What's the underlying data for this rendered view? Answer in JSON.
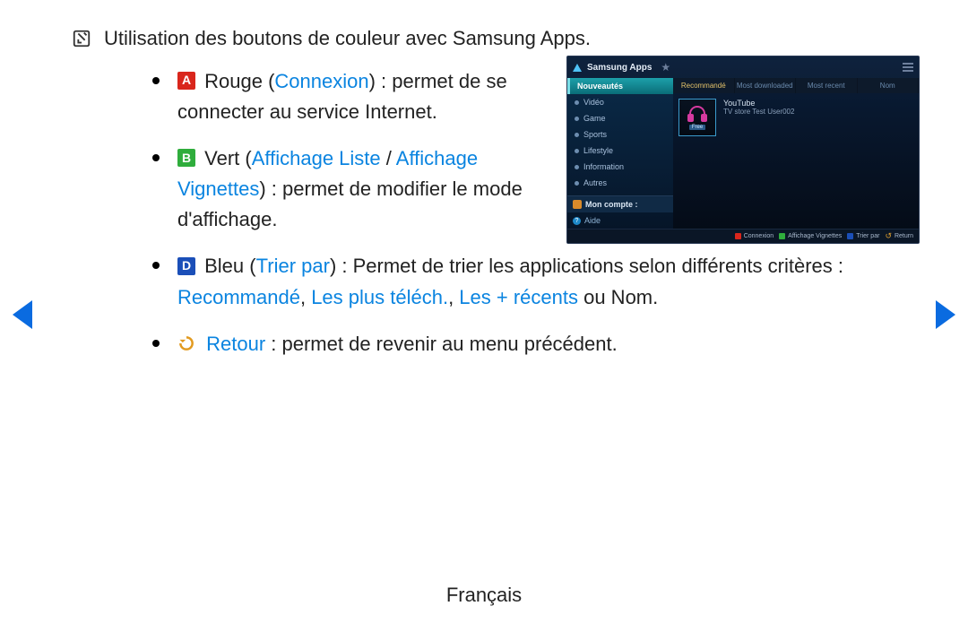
{
  "note": "Utilisation des boutons de couleur avec Samsung Apps.",
  "bullets": {
    "red": {
      "badge": "A",
      "color_word": "Rouge",
      "link": "Connexion",
      "rest": " : permet de se connecter au service Internet."
    },
    "green": {
      "badge": "B",
      "color_word": "Vert",
      "link1": "Affichage Liste",
      "sep": " / ",
      "link2": "Affichage Vignettes",
      "rest": " : permet de modifier le mode d'affichage."
    },
    "blue": {
      "badge": "D",
      "color_word": "Bleu",
      "link": "Trier par",
      "mid": " : Permet de trier les applications selon différents critères : ",
      "crit1": "Recommandé",
      "c1": ", ",
      "crit2": "Les plus téléch.",
      "c2": ", ",
      "crit3": "Les + récents",
      "tail": " ou Nom."
    },
    "return": {
      "link": "Retour",
      "rest": " : permet de revenir au menu précédent."
    }
  },
  "footer": "Français",
  "apps": {
    "title": "Samsung Apps",
    "sidebar": [
      "Nouveautés",
      "Vidéo",
      "Game",
      "Sports",
      "Lifestyle",
      "Information",
      "Autres"
    ],
    "account": "Mon compte :",
    "help": "Aide",
    "tabs": [
      "Recommandé",
      "Most downloaded",
      "Most recent",
      "Nom"
    ],
    "tile": {
      "name": "YouTube",
      "sub": "TV store Test User002",
      "price": "Free"
    },
    "footer_keys": {
      "a": "Connexion",
      "b": "Affichage Vignettes",
      "d": "Trier par",
      "ret": "Return"
    }
  }
}
